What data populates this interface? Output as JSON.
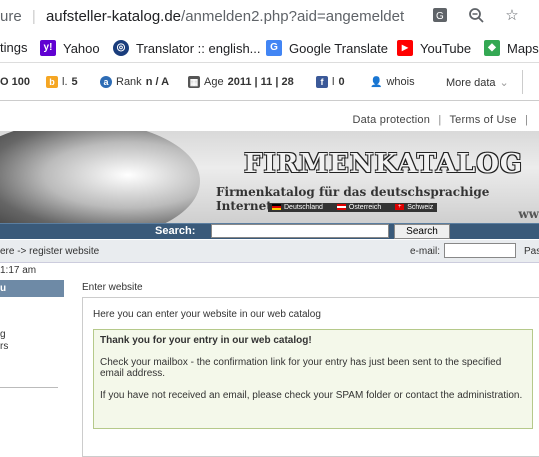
{
  "browser": {
    "url_prefix": "ure",
    "url_domain": "aufsteller-katalog.de",
    "url_path": "/anmelden2.php?aid=angemeldet",
    "icons": [
      "translate-icon",
      "zoom-icon",
      "star-icon"
    ]
  },
  "bookmarks": [
    {
      "label": "tings",
      "icon": ""
    },
    {
      "label": "Yahoo",
      "icon": "yahoo-icon",
      "color": "#6001d2",
      "glyph": "y!"
    },
    {
      "label": "Translator :: english...",
      "icon": "translator-icon",
      "color": "#1a3d7c",
      "glyph": "◎"
    },
    {
      "label": "Google Translate",
      "icon": "google-translate-icon",
      "color": "#4285f4",
      "glyph": "G"
    },
    {
      "label": "YouTube",
      "icon": "youtube-icon",
      "color": "#ff0000",
      "glyph": "▶"
    },
    {
      "label": "Maps",
      "icon": "maps-icon",
      "color": "#34a853",
      "glyph": "◆"
    }
  ],
  "seo": {
    "da": "O 100",
    "b_label": "l.",
    "b_value": "5",
    "rank_label": "Rank",
    "rank_value": "n / A",
    "age_label": "Age",
    "age_value": "2011 | 11 | 28",
    "fb_label": "l",
    "fb_value": "0",
    "whois": "whois",
    "more": "More data"
  },
  "page": {
    "toplinks": [
      "Data protection",
      "Terms of Use"
    ],
    "brand": "FIRMENKATALOG",
    "tagline": "Firmenkatalog für das deutschsprachige Internet",
    "languages": [
      "Deutschland",
      "Österreich",
      "Schweiz"
    ],
    "www": "ww",
    "search_label": "Search:",
    "search_value": "",
    "search_button": "Search",
    "breadcrumb": "ere -> register website",
    "email_label": "e-mail:",
    "email_value": "",
    "password_label": "Pas",
    "time": "1:17 am",
    "sidebar_head": "u",
    "sidebar_items": [
      "g",
      "rs"
    ],
    "main_title": "Enter website",
    "intro": "Here you can enter your website in our web catalog",
    "thanks_title": "Thank you for your entry in our web catalog!",
    "thanks_p1": "Check your mailbox - the confirmation link for your entry has just been sent to the specified email address.",
    "thanks_p2": "If you have not received an email, please check your SPAM folder or contact the administration."
  }
}
